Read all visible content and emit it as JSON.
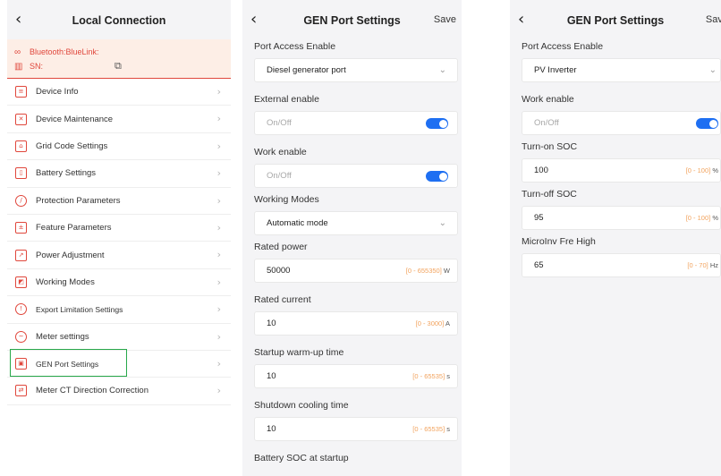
{
  "panel1": {
    "title": "Local Connection",
    "back": "‹",
    "bluetooth": "Bluetooth:BlueLink:",
    "sn": "SN:",
    "menu": [
      {
        "label": "Device Info",
        "icon": "device-info"
      },
      {
        "label": "Device Maintenance",
        "icon": "wrench"
      },
      {
        "label": "Grid Code Settings",
        "icon": "grid-tower"
      },
      {
        "label": "Battery Settings",
        "icon": "battery"
      },
      {
        "label": "Protection Parameters",
        "icon": "shield"
      },
      {
        "label": "Feature Parameters",
        "icon": "sliders"
      },
      {
        "label": "Power Adjustment",
        "icon": "power-adjust"
      },
      {
        "label": "Working Modes",
        "icon": "mode"
      },
      {
        "label": "Export Limitation Settings",
        "icon": "export-limit"
      },
      {
        "label": "Meter settings",
        "icon": "meter"
      },
      {
        "label": "GEN Port Settings",
        "icon": "gen-port"
      },
      {
        "label": "Meter CT Direction Correction",
        "icon": "ct-direction"
      }
    ]
  },
  "panel2": {
    "title": "GEN Port Settings",
    "save": "Save",
    "port_access_label": "Port Access Enable",
    "port_access_value": "Diesel generator port",
    "external_enable_label": "External enable",
    "external_enable_value": "On/Off",
    "work_enable_label": "Work enable",
    "work_enable_value": "On/Off",
    "working_modes_label": "Working Modes",
    "working_modes_value": "Automatic mode",
    "rated_power_label": "Rated power",
    "rated_power_value": "50000",
    "rated_power_range": "[0 - 655350]",
    "rated_power_unit": "W",
    "rated_current_label": "Rated current",
    "rated_current_value": "10",
    "rated_current_range": "[0 - 3000]",
    "rated_current_unit": "A",
    "warmup_label": "Startup warm-up time",
    "warmup_value": "10",
    "warmup_range": "[0 - 65535]",
    "warmup_unit": "s",
    "cooling_label": "Shutdown cooling time",
    "cooling_value": "10",
    "cooling_range": "[0 - 65535]",
    "cooling_unit": "s",
    "battery_soc_label": "Battery SOC at startup"
  },
  "panel3": {
    "title": "GEN Port Settings",
    "save": "Save",
    "port_access_label": "Port Access Enable",
    "port_access_value": "PV Inverter",
    "work_enable_label": "Work enable",
    "work_enable_value": "On/Off",
    "turn_on_label": "Turn-on SOC",
    "turn_on_value": "100",
    "turn_on_range": "[0 - 100]",
    "turn_on_unit": "%",
    "turn_off_label": "Turn-off SOC",
    "turn_off_value": "95",
    "turn_off_range": "[0 - 100]",
    "turn_off_unit": "%",
    "microinv_label": "MicroInv Fre High",
    "microinv_value": "65",
    "microinv_range": "[0 - 70]",
    "microinv_unit": "Hz"
  },
  "toggles": {
    "p2_external": true,
    "p2_work": true,
    "p3_work": true
  },
  "colors": {
    "accent_red": "#e0473c",
    "toggle_blue": "#1e6ff2",
    "highlight_green": "#27a84a",
    "range_orange": "#f2a35e"
  }
}
